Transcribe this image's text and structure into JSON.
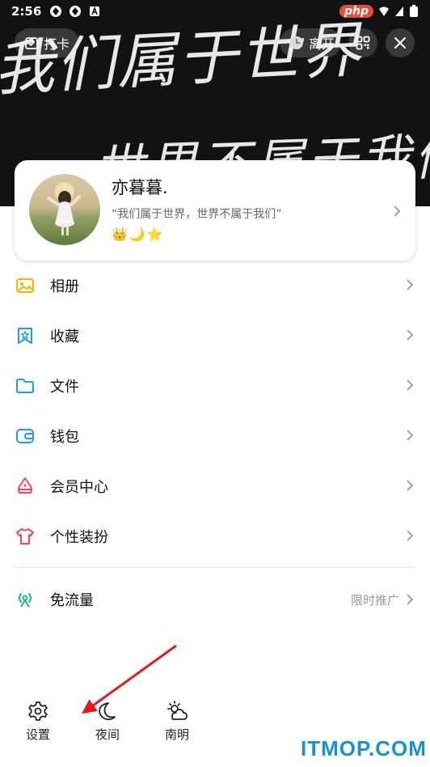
{
  "status_bar": {
    "time": "2:56",
    "site_badge": "php"
  },
  "banner": {
    "handwriting_line1": "我们属于世界",
    "handwriting_line2": "世界不属于我们",
    "checkin_label": "打卡",
    "leave_label": "离开"
  },
  "profile": {
    "nickname": "亦暮暮.",
    "signature": "“我们属于世界，世界不属于我们”",
    "badges": [
      "👑",
      "🌙",
      "⭐"
    ]
  },
  "menu": {
    "items": [
      {
        "label": "相册",
        "icon": "photo-album-icon",
        "color": "#f5b400"
      },
      {
        "label": "收藏",
        "icon": "favorites-icon",
        "color": "#1e9bf0"
      },
      {
        "label": "文件",
        "icon": "folder-icon",
        "color": "#1e9bf0"
      },
      {
        "label": "钱包",
        "icon": "wallet-icon",
        "color": "#1e9bf0"
      },
      {
        "label": "会员中心",
        "icon": "vip-icon",
        "color": "#f0445a"
      },
      {
        "label": "个性装扮",
        "icon": "tshirt-icon",
        "color": "#f0445a"
      }
    ],
    "data_free": {
      "label": "免流量",
      "tag": "限时推广",
      "icon": "broadcast-icon",
      "color": "#1fb97a"
    }
  },
  "bottom_bar": {
    "settings_label": "设置",
    "night_label": "夜间",
    "weather_label": "南明"
  },
  "watermark": "ITMOP.COM"
}
